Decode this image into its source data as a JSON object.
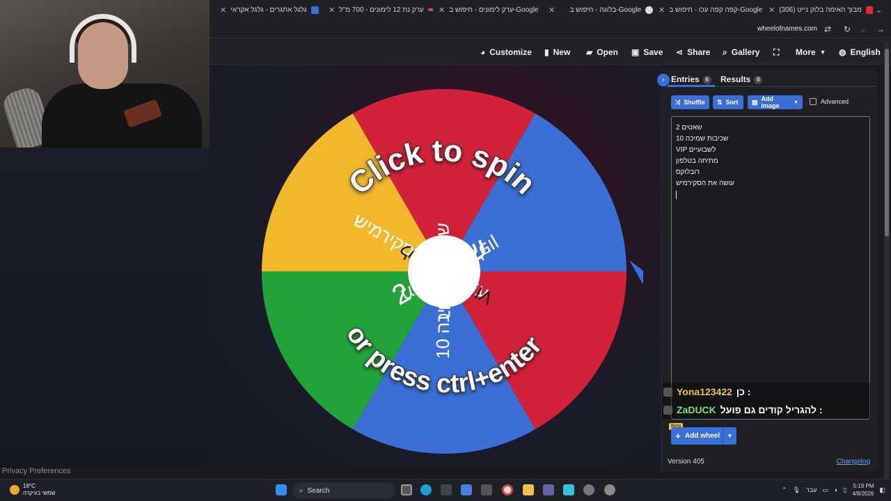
{
  "browser": {
    "tabs": [
      {
        "title": "גלגל אתגרים - גלגל אקראי",
        "color": "#3a6fd8"
      },
      {
        "title": "ערק נת 12 לימונים - 700 מ\"ל",
        "color": "#e23b4a"
      },
      {
        "title": "ערק לימונים - חיפוש ב-Google",
        "color": "#dddddd"
      },
      {
        "title": "בלוגה - חיפוש ב-Google",
        "color": "#dddddd"
      },
      {
        "title": "קפה קפה עכו - חיפוש ב-Google",
        "color": "#dddddd"
      },
      {
        "title": "(306) מבוך האימה בלוק נייט",
        "color": "#e8283a"
      }
    ],
    "url": "wheelofnames.com"
  },
  "header": {
    "items": [
      {
        "label": "Customize",
        "icon": "palette-icon"
      },
      {
        "label": "New",
        "icon": "file-icon"
      },
      {
        "label": "Open",
        "icon": "folder-icon"
      },
      {
        "label": "Save",
        "icon": "save-icon"
      },
      {
        "label": "Share",
        "icon": "share-icon"
      },
      {
        "label": "Gallery",
        "icon": "search-icon"
      },
      {
        "label": "",
        "icon": "fullscreen-icon"
      },
      {
        "label": "More",
        "icon": "chevron-down-icon"
      },
      {
        "label": "English",
        "icon": "globe-icon"
      }
    ]
  },
  "wheel": {
    "overlay_top": "Click to spin",
    "overlay_bottom": "or press ctrl+enter",
    "segments": [
      {
        "label": "שאטים 2",
        "color": "#3b6fd6"
      },
      {
        "label": "עושה את הסקירמיש",
        "color": "#d2223a"
      },
      {
        "label": "רובלוקס",
        "color": "#3b6fd6"
      },
      {
        "label": "מתיחה בטלפון",
        "color": "#22a33a"
      },
      {
        "label": "VIP לשבועיים",
        "color": "#f1b82c"
      },
      {
        "label": "שכיבות שמיכה 10",
        "color": "#d2223a"
      }
    ]
  },
  "panel": {
    "tab_entries": "Entries",
    "entries_count": "6",
    "tab_results": "Results",
    "results_count": "0",
    "btn_shuffle": "Shuffle",
    "btn_sort": "Sort",
    "btn_add_image": "Add image",
    "advanced": "Advanced",
    "entries": [
      "שאטים 2",
      "שכיבות שמיכה 10",
      "VIP לשבועיים",
      "מתיחה בטלפון",
      "רובלוקס",
      "עושה את הסקירמיש"
    ],
    "chat": [
      {
        "user": "Yona123422",
        "message": "כן :"
      },
      {
        "user": "ZaDUCK",
        "message": "להגריל קודים גם פועל :"
      }
    ],
    "beta": "Beta",
    "add_wheel": "Add wheel",
    "version": "Version 405",
    "changelog": "Changelog"
  },
  "privacy": "Privacy Preferences",
  "taskbar": {
    "temp": "18°C",
    "weather": "שמשי בעיקרה",
    "search": "Search",
    "lang": "עבר",
    "time": "5:19 PM",
    "date": "4/8/2026"
  }
}
